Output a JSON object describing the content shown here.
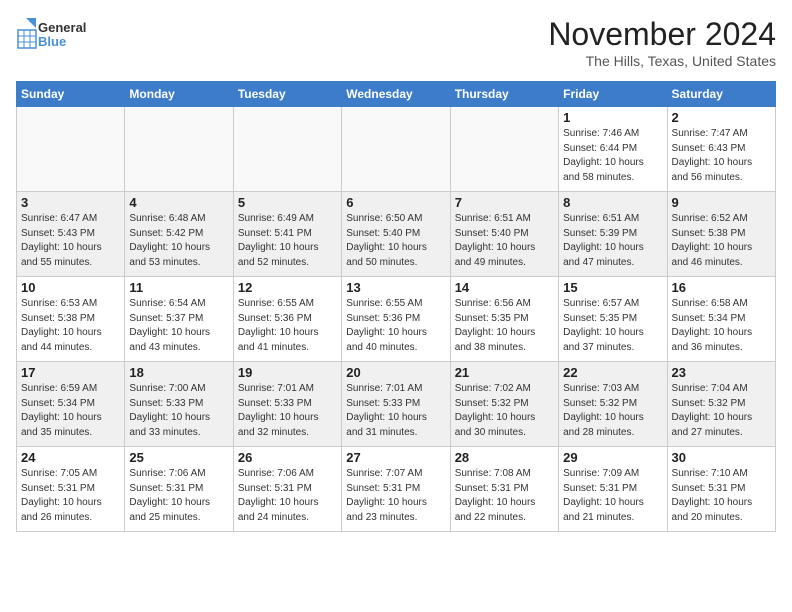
{
  "header": {
    "logo_general": "General",
    "logo_blue": "Blue",
    "month_year": "November 2024",
    "location": "The Hills, Texas, United States"
  },
  "weekdays": [
    "Sunday",
    "Monday",
    "Tuesday",
    "Wednesday",
    "Thursday",
    "Friday",
    "Saturday"
  ],
  "weeks": [
    [
      {
        "day": "",
        "info": ""
      },
      {
        "day": "",
        "info": ""
      },
      {
        "day": "",
        "info": ""
      },
      {
        "day": "",
        "info": ""
      },
      {
        "day": "",
        "info": ""
      },
      {
        "day": "1",
        "info": "Sunrise: 7:46 AM\nSunset: 6:44 PM\nDaylight: 10 hours\nand 58 minutes."
      },
      {
        "day": "2",
        "info": "Sunrise: 7:47 AM\nSunset: 6:43 PM\nDaylight: 10 hours\nand 56 minutes."
      }
    ],
    [
      {
        "day": "3",
        "info": "Sunrise: 6:47 AM\nSunset: 5:43 PM\nDaylight: 10 hours\nand 55 minutes."
      },
      {
        "day": "4",
        "info": "Sunrise: 6:48 AM\nSunset: 5:42 PM\nDaylight: 10 hours\nand 53 minutes."
      },
      {
        "day": "5",
        "info": "Sunrise: 6:49 AM\nSunset: 5:41 PM\nDaylight: 10 hours\nand 52 minutes."
      },
      {
        "day": "6",
        "info": "Sunrise: 6:50 AM\nSunset: 5:40 PM\nDaylight: 10 hours\nand 50 minutes."
      },
      {
        "day": "7",
        "info": "Sunrise: 6:51 AM\nSunset: 5:40 PM\nDaylight: 10 hours\nand 49 minutes."
      },
      {
        "day": "8",
        "info": "Sunrise: 6:51 AM\nSunset: 5:39 PM\nDaylight: 10 hours\nand 47 minutes."
      },
      {
        "day": "9",
        "info": "Sunrise: 6:52 AM\nSunset: 5:38 PM\nDaylight: 10 hours\nand 46 minutes."
      }
    ],
    [
      {
        "day": "10",
        "info": "Sunrise: 6:53 AM\nSunset: 5:38 PM\nDaylight: 10 hours\nand 44 minutes."
      },
      {
        "day": "11",
        "info": "Sunrise: 6:54 AM\nSunset: 5:37 PM\nDaylight: 10 hours\nand 43 minutes."
      },
      {
        "day": "12",
        "info": "Sunrise: 6:55 AM\nSunset: 5:36 PM\nDaylight: 10 hours\nand 41 minutes."
      },
      {
        "day": "13",
        "info": "Sunrise: 6:55 AM\nSunset: 5:36 PM\nDaylight: 10 hours\nand 40 minutes."
      },
      {
        "day": "14",
        "info": "Sunrise: 6:56 AM\nSunset: 5:35 PM\nDaylight: 10 hours\nand 38 minutes."
      },
      {
        "day": "15",
        "info": "Sunrise: 6:57 AM\nSunset: 5:35 PM\nDaylight: 10 hours\nand 37 minutes."
      },
      {
        "day": "16",
        "info": "Sunrise: 6:58 AM\nSunset: 5:34 PM\nDaylight: 10 hours\nand 36 minutes."
      }
    ],
    [
      {
        "day": "17",
        "info": "Sunrise: 6:59 AM\nSunset: 5:34 PM\nDaylight: 10 hours\nand 35 minutes."
      },
      {
        "day": "18",
        "info": "Sunrise: 7:00 AM\nSunset: 5:33 PM\nDaylight: 10 hours\nand 33 minutes."
      },
      {
        "day": "19",
        "info": "Sunrise: 7:01 AM\nSunset: 5:33 PM\nDaylight: 10 hours\nand 32 minutes."
      },
      {
        "day": "20",
        "info": "Sunrise: 7:01 AM\nSunset: 5:33 PM\nDaylight: 10 hours\nand 31 minutes."
      },
      {
        "day": "21",
        "info": "Sunrise: 7:02 AM\nSunset: 5:32 PM\nDaylight: 10 hours\nand 30 minutes."
      },
      {
        "day": "22",
        "info": "Sunrise: 7:03 AM\nSunset: 5:32 PM\nDaylight: 10 hours\nand 28 minutes."
      },
      {
        "day": "23",
        "info": "Sunrise: 7:04 AM\nSunset: 5:32 PM\nDaylight: 10 hours\nand 27 minutes."
      }
    ],
    [
      {
        "day": "24",
        "info": "Sunrise: 7:05 AM\nSunset: 5:31 PM\nDaylight: 10 hours\nand 26 minutes."
      },
      {
        "day": "25",
        "info": "Sunrise: 7:06 AM\nSunset: 5:31 PM\nDaylight: 10 hours\nand 25 minutes."
      },
      {
        "day": "26",
        "info": "Sunrise: 7:06 AM\nSunset: 5:31 PM\nDaylight: 10 hours\nand 24 minutes."
      },
      {
        "day": "27",
        "info": "Sunrise: 7:07 AM\nSunset: 5:31 PM\nDaylight: 10 hours\nand 23 minutes."
      },
      {
        "day": "28",
        "info": "Sunrise: 7:08 AM\nSunset: 5:31 PM\nDaylight: 10 hours\nand 22 minutes."
      },
      {
        "day": "29",
        "info": "Sunrise: 7:09 AM\nSunset: 5:31 PM\nDaylight: 10 hours\nand 21 minutes."
      },
      {
        "day": "30",
        "info": "Sunrise: 7:10 AM\nSunset: 5:31 PM\nDaylight: 10 hours\nand 20 minutes."
      }
    ]
  ]
}
